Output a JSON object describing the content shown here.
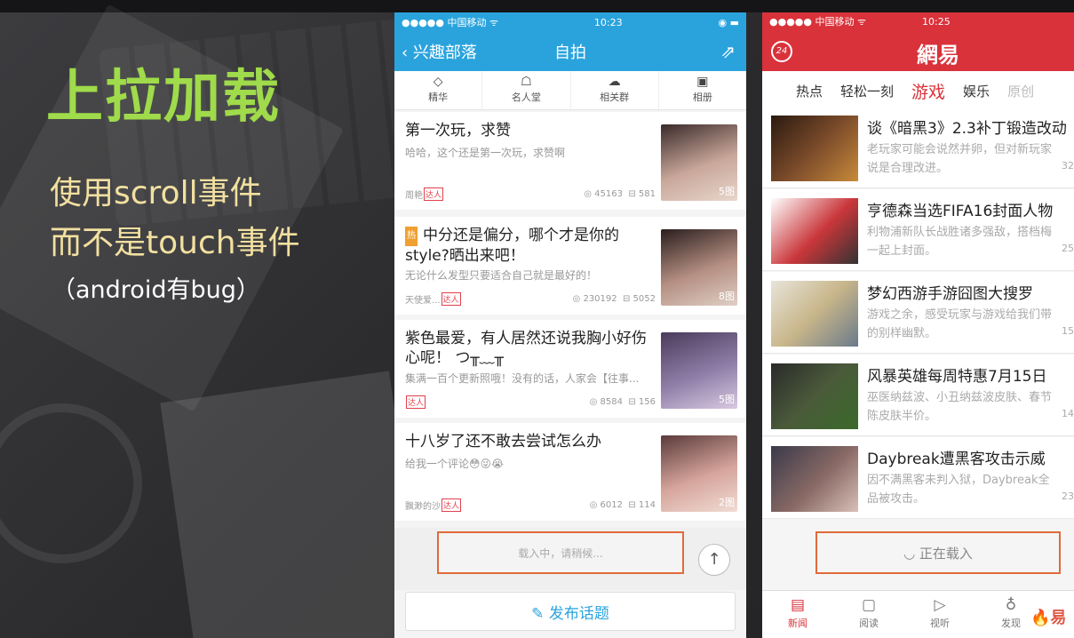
{
  "slide": {
    "title": "上拉加载",
    "line1": "使用scroll事件",
    "line2": "而不是touch事件",
    "note": "（android有bug）"
  },
  "phone1": {
    "status": {
      "carrier": "●●●●● 中国移动 ᯤ",
      "time": "10:23",
      "battery": "◉ ▬"
    },
    "nav": {
      "back_label": "‹ 兴趣部落",
      "title": "自拍",
      "share_icon": "share-icon"
    },
    "tabs": [
      {
        "label": "精华",
        "icon": "◇"
      },
      {
        "label": "名人堂",
        "icon": "☖"
      },
      {
        "label": "相关群",
        "icon": "☁"
      },
      {
        "label": "相册",
        "icon": "▣"
      }
    ],
    "posts": [
      {
        "title": "第一次玩，求赞",
        "desc": "哈哈，这个还是第一次玩，求赞啊",
        "author": "周艳",
        "badge": "达人",
        "views": "◎ 45163",
        "comments": "⊟ 581",
        "count": "5图",
        "tag": "",
        "thumb_color": "#c9a79a"
      },
      {
        "title": "中分还是偏分，哪个才是你的style?晒出来吧！",
        "desc": "无论什么发型只要适合自己就是最好的！",
        "author": "天使爱...",
        "badge": "达人",
        "views": "◎ 230192",
        "comments": "⊟ 5052",
        "count": "8图",
        "tag": "热",
        "thumb_color": "#b58f82"
      },
      {
        "title": "紫色最爱，有人居然还说我胸小好伤心呢！ つ╥﹏╥",
        "desc": "集满一百个更新照哦！没有的话，人家会【往事...",
        "author": "",
        "badge": "达人",
        "views": "◎ 8584",
        "comments": "⊟ 156",
        "count": "5图",
        "tag": "",
        "thumb_color": "#8f7fa8"
      },
      {
        "title": "十八岁了还不敢去尝试怎么办",
        "desc": "给我一个评论😳😜😭",
        "author": "飘渺的沙",
        "badge": "达人",
        "views": "◎ 6012",
        "comments": "⊟ 114",
        "count": "2图",
        "tag": "",
        "thumb_color": "#d6a59c"
      }
    ],
    "loading": "载入中，请稍候...",
    "to_top": "↑",
    "publish": "✎ 发布话题"
  },
  "phone2": {
    "status": {
      "carrier": "●●●●● 中国移动 ᯤ",
      "time": "10:25"
    },
    "header": {
      "logo": "24",
      "brand": "網易"
    },
    "channels": [
      {
        "label": "热点",
        "state": "normal"
      },
      {
        "label": "轻松一刻",
        "state": "normal"
      },
      {
        "label": "游戏",
        "state": "active"
      },
      {
        "label": "娱乐",
        "state": "normal"
      },
      {
        "label": "原创",
        "state": "faded"
      }
    ],
    "news": [
      {
        "title": "谈《暗黑3》2.3补丁锻造改动",
        "desc1": "老玩家可能会说然并卵，但对新玩家",
        "desc2": "说是合理改进。",
        "count": "32",
        "img_color": "#7a4a2a"
      },
      {
        "title": "亨德森当选FIFA16封面人物",
        "desc1": "利物浦新队长战胜诸多强敌，搭档梅",
        "desc2": "一起上封面。",
        "count": "25",
        "img_color": "#c9363a"
      },
      {
        "title": "梦幻西游手游囧图大搜罗",
        "desc1": "游戏之余，感受玩家与游戏给我们带",
        "desc2": "的别样幽默。",
        "count": "15",
        "img_color": "#c8b68a"
      },
      {
        "title": "风暴英雄每周特惠7月15日",
        "desc1": "巫医纳兹波、小丑纳兹波皮肤、春节",
        "desc2": "陈皮肤半价。",
        "count": "14",
        "img_color": "#4a5a3a"
      },
      {
        "title": "Daybreak遭黑客攻击示威",
        "desc1": "因不满黑客未判入狱，Daybreak全",
        "desc2": "品被攻击。",
        "count": "23",
        "img_color": "#8a6a66"
      }
    ],
    "loading": "◡ 正在载入",
    "bottom_tabs": [
      {
        "label": "新闻",
        "icon": "▤",
        "active": true
      },
      {
        "label": "阅读",
        "icon": "▢",
        "active": false
      },
      {
        "label": "视听",
        "icon": "▷",
        "active": false
      },
      {
        "label": "发现",
        "icon": "♁",
        "active": false
      }
    ],
    "corner_logo": "易"
  }
}
